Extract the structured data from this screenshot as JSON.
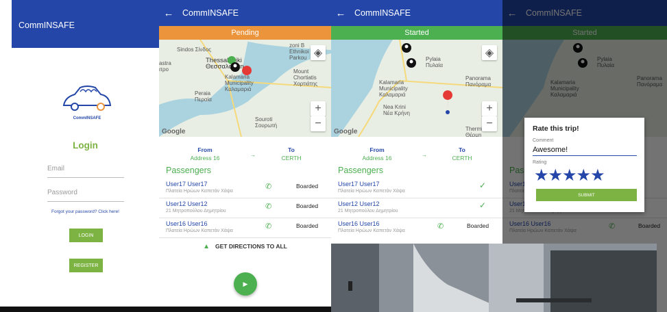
{
  "app_title": "CommINSAFE",
  "login": {
    "logo_name": "CommINSAFE",
    "heading": "Login",
    "email_placeholder": "Email",
    "password_placeholder": "Password",
    "forgot": "Forgot your password? Click here!",
    "login_btn": "LOGIN",
    "register_btn": "REGISTER"
  },
  "trip": {
    "status_pending": "Pending",
    "status_started": "Started",
    "from_label": "From",
    "from_value": "Address 16",
    "to_label": "To",
    "to_value": "CERTH",
    "passengers_title": "Passengers",
    "passengers": [
      {
        "name": "User17 User17",
        "address": "Πλατεία Ηρώων Καπετάν Χάψα",
        "status": "Boarded"
      },
      {
        "name": "User12 User12",
        "address": "21 Μητροπούλου Δημητρίου",
        "status": "Boarded"
      },
      {
        "name": "User16 User16",
        "address": "Πλατεία Ηρώων Καπετάν Χάψα",
        "status": "Boarded"
      }
    ],
    "directions": "GET DIRECTIONS TO ALL"
  },
  "map_labels": {
    "p2": [
      "Sindos Σίνδος",
      "astra ιτρο",
      "Thessaloniki Θεσσαλονίκη",
      "Kalamaria Municipality Καλαμαριά",
      "Mount Chortiatis Χορτιάτης",
      "zoni B Ethnikoi Parkou",
      "Peraia Περαία",
      "Souroti Σουρωτή"
    ],
    "p3": [
      "Pylaia Πυλαία",
      "Kalamaria Municipality Καλαμαριά",
      "Panorama Πανόραμα",
      "Nea Krini Νέα Κρήνη",
      "Thermi Θέρμη"
    ]
  },
  "google_label": "Google",
  "rating_dialog": {
    "title": "Rate this trip!",
    "comment_label": "Comment",
    "comment_value": "Awesome!",
    "rating_label": "Rating",
    "rating_value": 5,
    "stars": "★★★★★",
    "submit": "SUBMIT"
  },
  "icons": {
    "back": "←",
    "phone": "📞",
    "check": "✓",
    "locate": "◈",
    "zoom_in": "+",
    "zoom_out": "−",
    "navigate": "▲",
    "play": "▶"
  },
  "colors": {
    "appbar": "#2346a8",
    "pending": "#ec943b",
    "started": "#4caf50",
    "accent": "#7cb342"
  }
}
